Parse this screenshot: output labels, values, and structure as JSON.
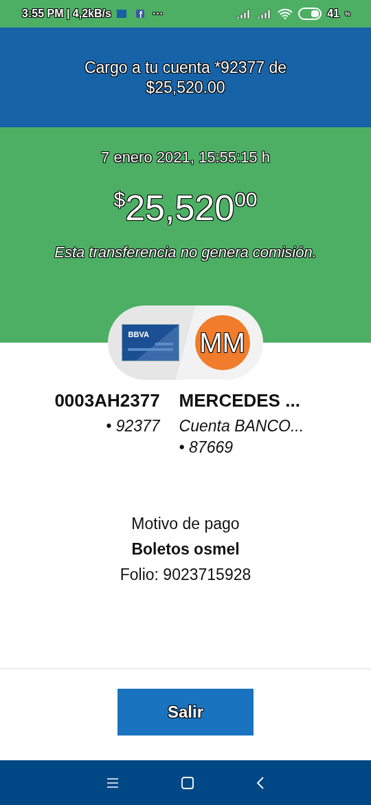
{
  "status_bar": {
    "time": "3:55 PM | 4,2kB/s",
    "more": "···",
    "battery": "41",
    "battery_unit": "%"
  },
  "toast": {
    "message": "Cargo a tu cuenta *92377 de $25,520.00"
  },
  "header": {
    "date": "7 enero 2021, 15:55:15 h",
    "currency": "$",
    "amount": "25,520",
    "cents": "00",
    "note": "Esta transferencia no genera comisión."
  },
  "origin": {
    "card_brand": "BBVA",
    "name": "0003AH2377",
    "account": "• 92377"
  },
  "destination": {
    "initials": "MM",
    "name": "MERCEDES ...",
    "bank": "Cuenta BANCO...",
    "account": "• 87669"
  },
  "details": {
    "label": "Motivo de pago",
    "reason": "Boletos osmel",
    "folio": "Folio: 9023715928"
  },
  "buttons": [
    "Salir"
  ]
}
